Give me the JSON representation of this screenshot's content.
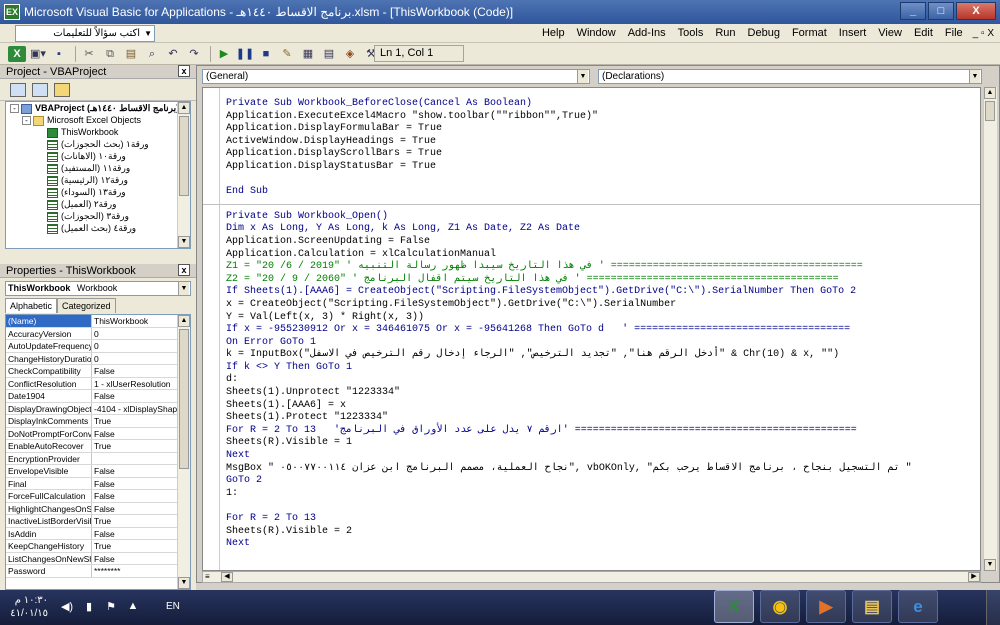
{
  "window": {
    "title": "Microsoft Visual Basic for Applications - برنامج الاقساط ١٤٤٠هـ.xlsm - [ThisWorkbook (Code)]",
    "app_icon": "EX",
    "min": "_",
    "max": "□",
    "close": "X"
  },
  "menubar": {
    "ask_placeholder": "اكتب سؤالاً للتعليمات",
    "items": [
      "Help",
      "Window",
      "Add-Ins",
      "Tools",
      "Run",
      "Debug",
      "Format",
      "Insert",
      "View",
      "Edit",
      "File"
    ],
    "mdi_buttons": "_ ▫ X"
  },
  "toolbar": {
    "position": "Ln 1, Col 1"
  },
  "project_panel": {
    "title": "Project - VBAProject",
    "close": "x",
    "tree": [
      {
        "label": "VBAProject (برنامج الاقساط ١٤٤٠هـ)",
        "level": 0,
        "type": "proj",
        "toggle": "-"
      },
      {
        "label": "Microsoft Excel Objects",
        "level": 1,
        "type": "fold",
        "toggle": "-"
      },
      {
        "label": "ThisWorkbook",
        "level": 2,
        "type": "book",
        "toggle": ""
      },
      {
        "label": "ورقة١ (بحث الحجوزات)",
        "level": 2,
        "type": "sheet",
        "toggle": ""
      },
      {
        "label": "ورقة١٠ (الاهانات)",
        "level": 2,
        "type": "sheet",
        "toggle": ""
      },
      {
        "label": "ورقة١١ (المستفيد)",
        "level": 2,
        "type": "sheet",
        "toggle": ""
      },
      {
        "label": "ورقة١٢ (الرئيسية)",
        "level": 2,
        "type": "sheet",
        "toggle": ""
      },
      {
        "label": "ورقة١٣ (السوداء)",
        "level": 2,
        "type": "sheet",
        "toggle": ""
      },
      {
        "label": "ورقة٢ (العميل)",
        "level": 2,
        "type": "sheet",
        "toggle": ""
      },
      {
        "label": "ورقة٣ (الحجوزات)",
        "level": 2,
        "type": "sheet",
        "toggle": ""
      },
      {
        "label": "ورقة٤ (بحث العميل)",
        "level": 2,
        "type": "sheet",
        "toggle": ""
      }
    ]
  },
  "properties_panel": {
    "title": "Properties - ThisWorkbook",
    "close": "x",
    "selector_name": "ThisWorkbook",
    "selector_type": "Workbook",
    "tabs": [
      "Alphabetic",
      "Categorized"
    ],
    "rows": [
      [
        "(Name)",
        "ThisWorkbook"
      ],
      [
        "AccuracyVersion",
        "0"
      ],
      [
        "AutoUpdateFrequency",
        "0"
      ],
      [
        "ChangeHistoryDuration",
        "0"
      ],
      [
        "CheckCompatibility",
        "False"
      ],
      [
        "ConflictResolution",
        "1 - xlUserResolution"
      ],
      [
        "Date1904",
        "False"
      ],
      [
        "DisplayDrawingObjects",
        "-4104 - xlDisplayShapes"
      ],
      [
        "DisplayInkComments",
        "True"
      ],
      [
        "DoNotPromptForConvert",
        "False"
      ],
      [
        "EnableAutoRecover",
        "True"
      ],
      [
        "EncryptionProvider",
        ""
      ],
      [
        "EnvelopeVisible",
        "False"
      ],
      [
        "Final",
        "False"
      ],
      [
        "ForceFullCalculation",
        "False"
      ],
      [
        "HighlightChangesOnScreen",
        "False"
      ],
      [
        "InactiveListBorderVisible",
        "True"
      ],
      [
        "IsAddin",
        "False"
      ],
      [
        "KeepChangeHistory",
        "True"
      ],
      [
        "ListChangesOnNewSheet",
        "False"
      ],
      [
        "Password",
        "********"
      ]
    ]
  },
  "code_window": {
    "object_combo": "(General)",
    "proc_combo": "(Declarations)",
    "lines": [
      {
        "t": "Private Sub Workbook_BeforeClose(Cancel As Boolean)",
        "c": "kw"
      },
      {
        "t": "Application.ExecuteExcel4Macro \"show.toolbar(\"\"ribbon\"\",True)\"",
        "c": ""
      },
      {
        "t": "Application.DisplayFormulaBar = True",
        "c": ""
      },
      {
        "t": "ActiveWindow.DisplayHeadings = True",
        "c": ""
      },
      {
        "t": "Application.DisplayScrollBars = True",
        "c": ""
      },
      {
        "t": "Application.DisplayStatusBar = True",
        "c": ""
      },
      {
        "t": "",
        "c": ""
      },
      {
        "t": "End Sub",
        "c": "kw"
      },
      {
        "t": "---",
        "c": "div"
      },
      {
        "t": "Private Sub Workbook_Open()",
        "c": "kw"
      },
      {
        "t": "Dim x As Long, Y As Long, k As Long, Z1 As Date, Z2 As Date",
        "c": "kw"
      },
      {
        "t": "Application.ScreenUpdating = False",
        "c": ""
      },
      {
        "t": "Application.Calculation = xlCalculationManual",
        "c": ""
      },
      {
        "t": "Z1 = \"20 /6 / 2019\" ' في هذا التاريخ سيبدا ظهور رسالة التنبيه ' ==========================================",
        "c": "cm"
      },
      {
        "t": "Z2 = \"20 / 9 / 2060\" ' في هذا التاريخ سيتم اقفال البرنامج ' ==========================================",
        "c": "cm"
      },
      {
        "t": "If Sheets(1).[AAA6] = CreateObject(\"Scripting.FileSystemObject\").GetDrive(\"C:\\\").SerialNumber Then GoTo 2",
        "c": "kw"
      },
      {
        "t": "x = CreateObject(\"Scripting.FileSystemObject\").GetDrive(\"C:\\\").SerialNumber",
        "c": ""
      },
      {
        "t": "Y = Val(Left(x, 3) * Right(x, 3))",
        "c": ""
      },
      {
        "t": "If x = -955230912 Or x = 346461075 Or x = -95641268 Then GoTo d   ' ====================================",
        "c": "kw"
      },
      {
        "t": "On Error GoTo 1",
        "c": "kw"
      },
      {
        "t": "k = InputBox(\"أدخل الرقم هنا\", \"تجديد الترخيص\", \"الرجاء إدخال رقم الترخيص في الاسفل\" & Chr(10) & x, \"\")",
        "c": ""
      },
      {
        "t": "If k <> Y Then GoTo 1",
        "c": "kw"
      },
      {
        "t": "d:",
        "c": ""
      },
      {
        "t": "Sheets(1).Unprotect \"1223334\"",
        "c": ""
      },
      {
        "t": "Sheets(1).[AAA6] = x",
        "c": ""
      },
      {
        "t": "Sheets(1).Protect \"1223334\"",
        "c": ""
      },
      {
        "t": "For R = 2 To 13   'ارقم ٧ يدل على عدد الأوراق في البرنامج' ===============================================",
        "c": "kw"
      },
      {
        "t": "Sheets(R).Visible = 1",
        "c": ""
      },
      {
        "t": "Next",
        "c": "kw"
      },
      {
        "t": "MsgBox \" نجاح العملية، مصمم البرنامج ابن عزان ٠٥٠٠٧٧٠٠١١٤\", vbOKOnly, \"تم التسجيل بنجاح ، برنامج الاقساط يرحب بكم \"",
        "c": ""
      },
      {
        "t": "GoTo 2",
        "c": "kw"
      },
      {
        "t": "1:",
        "c": ""
      },
      {
        "t": "",
        "c": ""
      },
      {
        "t": "For R = 2 To 13",
        "c": "kw"
      },
      {
        "t": "Sheets(R).Visible = 2",
        "c": ""
      },
      {
        "t": "Next",
        "c": "kw"
      }
    ]
  },
  "taskbar": {
    "time": "١٠:٣٠ م",
    "date": "٤١/٠١/١٥",
    "lang": "EN",
    "apps": [
      {
        "name": "excel-app",
        "glyph": "X",
        "color": "#2d8b3a"
      },
      {
        "name": "chrome-app",
        "glyph": "◉",
        "color": "#f4c20d"
      },
      {
        "name": "media-app",
        "glyph": "▶",
        "color": "#e0732a"
      },
      {
        "name": "explorer-app",
        "glyph": "▤",
        "color": "#e8c35a"
      },
      {
        "name": "ie-app",
        "glyph": "e",
        "color": "#3a8fe0"
      }
    ]
  }
}
